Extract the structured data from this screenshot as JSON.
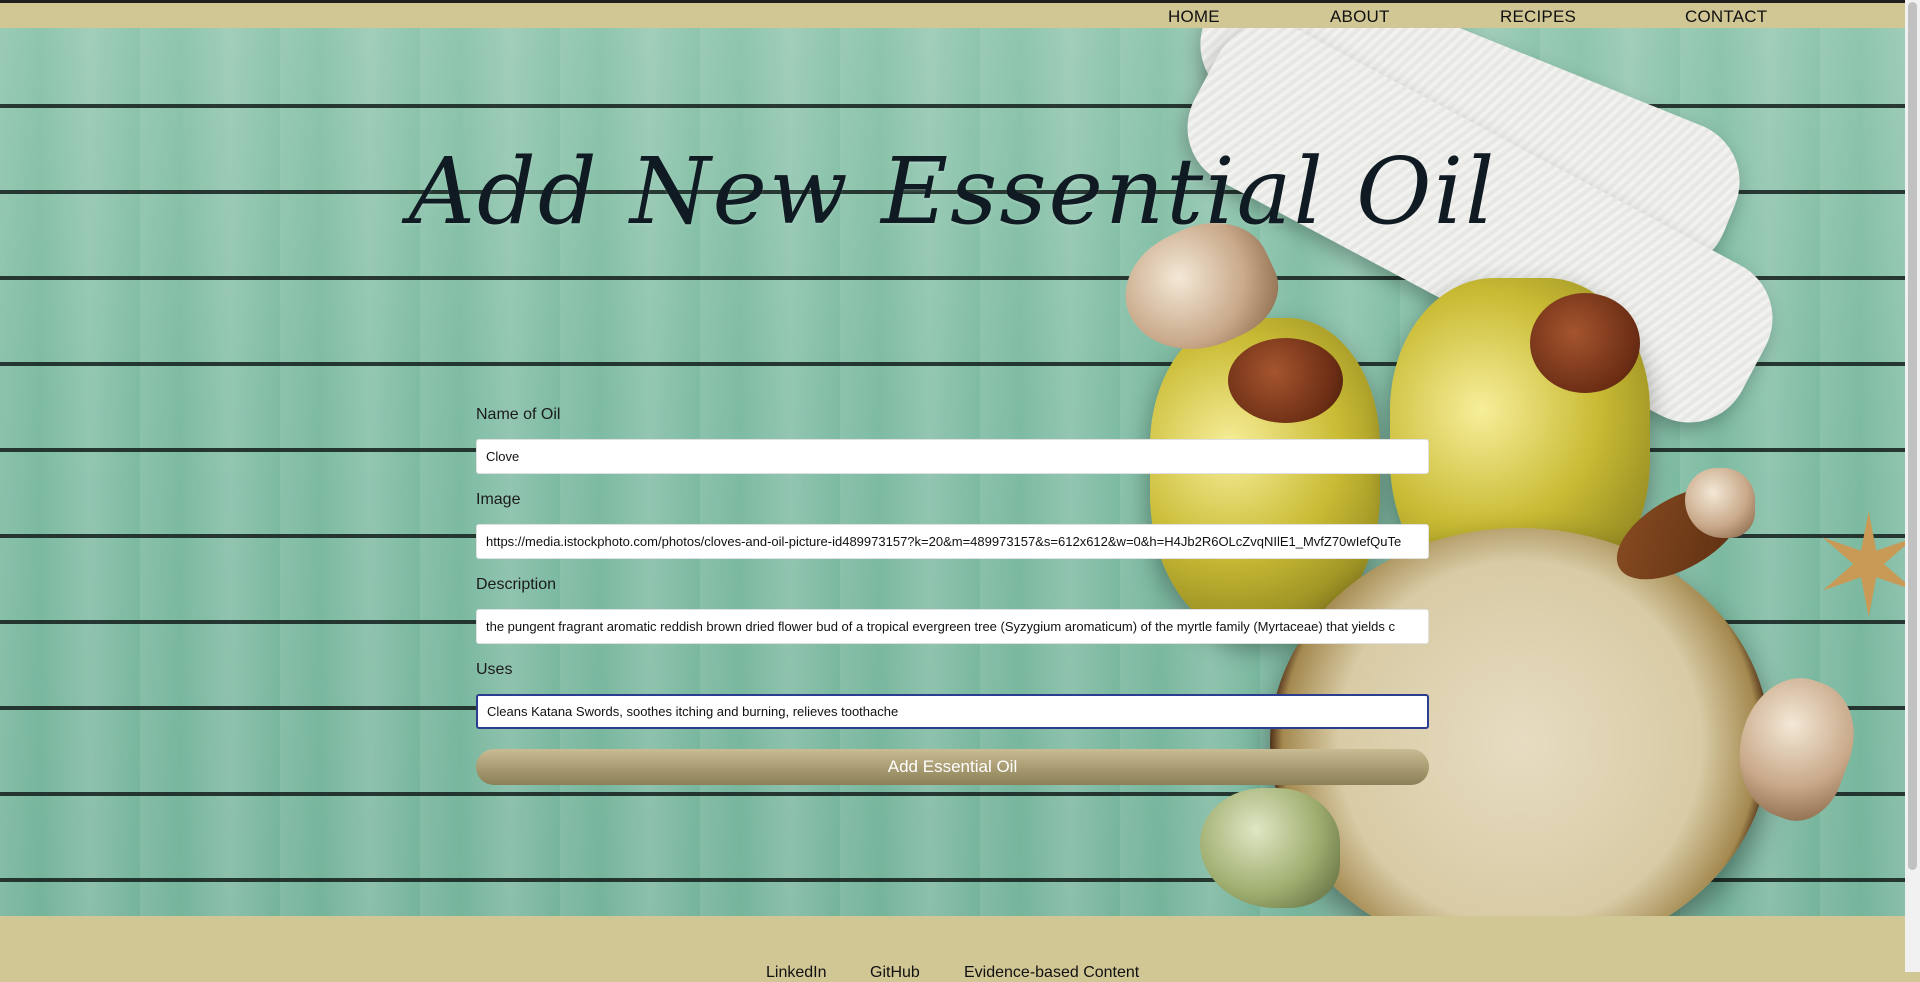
{
  "nav": {
    "home": "HOME",
    "about": "ABOUT",
    "recipes": "RECIPES",
    "contact": "CONTACT"
  },
  "hero": {
    "title": "Add New Essential Oil"
  },
  "form": {
    "name_label": "Name of Oil",
    "name_value": "Clove",
    "image_label": "Image",
    "image_value": "https://media.istockphoto.com/photos/cloves-and-oil-picture-id489973157?k=20&m=489973157&s=612x612&w=0&h=H4Jb2R6OLcZvqNIlE1_MvfZ70wIefQuTe",
    "description_label": "Description",
    "description_value": "the pungent fragrant aromatic reddish brown dried flower bud of a tropical evergreen tree (Syzygium aromaticum) of the myrtle family (Myrtaceae) that yields c",
    "uses_label": "Uses",
    "uses_value": "Cleans Katana Swords, soothes itching and burning, relieves toothache",
    "submit_label": "Add Essential Oil"
  },
  "footer": {
    "linkedin": "LinkedIn",
    "github": "GitHub",
    "evidence": "Evidence-based Content"
  },
  "colors": {
    "nav_bg": "#d1c795",
    "button_gradient_top": "#c9bc94",
    "button_gradient_bottom": "#8a7f57",
    "focus_border": "#2a3d8f"
  }
}
